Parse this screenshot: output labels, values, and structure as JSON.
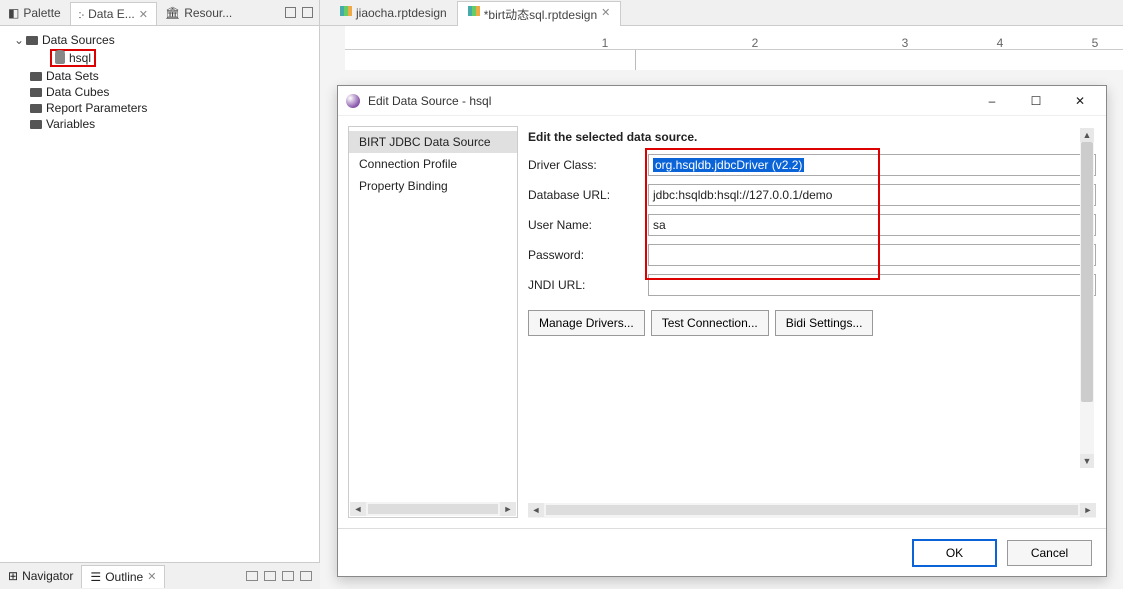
{
  "left": {
    "tabs": [
      "Palette",
      "Data E...",
      "Resour..."
    ],
    "active_tab": 1,
    "tree": {
      "root": "Data Sources",
      "source_item": "hsql",
      "items": [
        "Data Sets",
        "Data Cubes",
        "Report Parameters",
        "Variables"
      ]
    }
  },
  "bottom": {
    "tabs": [
      "Navigator",
      "Outline"
    ],
    "active_tab": 1
  },
  "editor": {
    "tabs": [
      {
        "label": "jiaocha.rptdesign",
        "active": false,
        "dirty": false
      },
      {
        "label": "*birt动态sql.rptdesign",
        "active": true,
        "dirty": false
      }
    ],
    "ruler_marks": [
      "",
      "1",
      "2",
      "3",
      "4",
      "5"
    ]
  },
  "dialog": {
    "title": "Edit Data Source - hsql",
    "sidebar": [
      "BIRT JDBC Data Source",
      "Connection Profile",
      "Property Binding"
    ],
    "selected_sidebar": 0,
    "section_title": "Edit the selected data source.",
    "fields": {
      "driver_label": "Driver Class:",
      "driver_value": "org.hsqldb.jdbcDriver (v2.2)",
      "dburl_label": "Database URL:",
      "dburl_value": "jdbc:hsqldb:hsql://127.0.0.1/demo",
      "user_label": "User Name:",
      "user_value": "sa",
      "pass_label": "Password:",
      "pass_value": "",
      "jndi_label": "JNDI URL:",
      "jndi_value": ""
    },
    "buttons": {
      "manage": "Manage Drivers...",
      "test": "Test Connection...",
      "bidi": "Bidi Settings..."
    },
    "footer": {
      "ok": "OK",
      "cancel": "Cancel"
    },
    "win": {
      "min": "–",
      "max": "☐",
      "close": "✕"
    },
    "close_tab": "✕"
  }
}
